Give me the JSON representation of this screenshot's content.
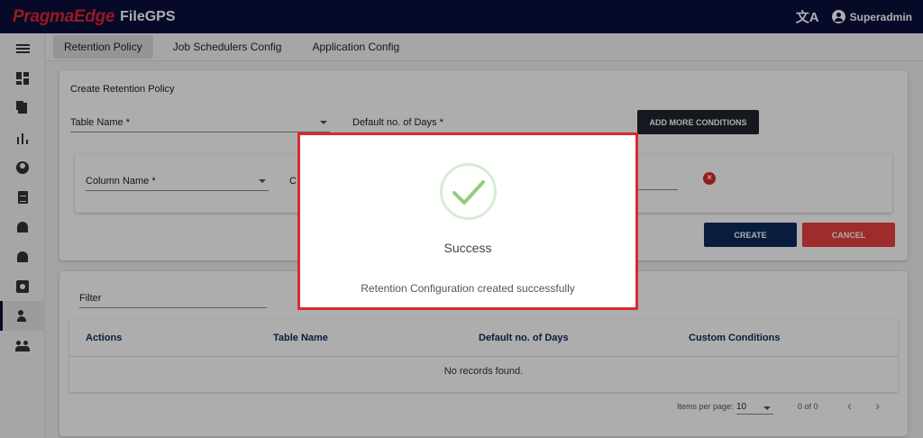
{
  "header": {
    "brand": "PragmaEdge",
    "product": "FileGPS",
    "translate_icon": "translate-icon",
    "user_name": "Superadmin"
  },
  "sidebar": {
    "items": [
      {
        "name": "menu",
        "icon": "hamburger-menu-icon"
      },
      {
        "name": "dashboard",
        "icon": "dashboard-icon"
      },
      {
        "name": "files",
        "icon": "file-copy-icon"
      },
      {
        "name": "reports",
        "icon": "bar-chart-icon"
      },
      {
        "name": "account",
        "icon": "account-circle-icon"
      },
      {
        "name": "documents",
        "icon": "description-icon"
      },
      {
        "name": "alerts",
        "icon": "notification-bell-icon"
      },
      {
        "name": "alarms",
        "icon": "alarm-bell-icon"
      },
      {
        "name": "settings",
        "icon": "settings-box-icon"
      },
      {
        "name": "user-config",
        "icon": "user-settings-icon",
        "active": true
      },
      {
        "name": "groups",
        "icon": "group-icon"
      }
    ]
  },
  "tabs": [
    {
      "label": "Retention Policy",
      "active": true
    },
    {
      "label": "Job Schedulers Config"
    },
    {
      "label": "Application Config"
    }
  ],
  "form": {
    "title": "Create Retention Policy",
    "table_name_label": "Table Name *",
    "default_days_label": "Default no. of Days *",
    "add_conditions_label": "ADD MORE CONDITIONS",
    "column_name_label": "Column Name *",
    "condition_partial_label": "C",
    "create_label": "CREATE",
    "cancel_label": "CANCEL"
  },
  "list": {
    "filter_label": "Filter",
    "columns": [
      "Actions",
      "Table Name",
      "Default no. of Days",
      "Custom Conditions"
    ],
    "empty_message": "No records found.",
    "items_per_page_label": "Items per page:",
    "items_per_page_value": "10",
    "range_label": "0 of 0"
  },
  "dialog": {
    "title": "Success",
    "message": "Retention Configuration created successfully"
  },
  "colors": {
    "topbar": "#0a0f3c",
    "brand_red": "#e1262e",
    "create_button": "#0c2b5c",
    "cancel_button": "#e8413e",
    "dialog_highlight": "#d72b31",
    "success_check": "#8fce7e"
  }
}
